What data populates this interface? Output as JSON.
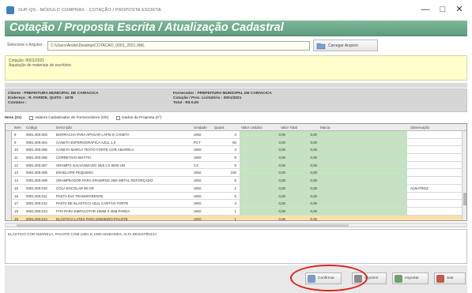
{
  "window": {
    "title": "SUP-QS - MÓDULO COMPRAS - COTAÇÃO / PROPOSTA ESCRITA",
    "controls": [
      "—",
      "□",
      "✕"
    ]
  },
  "header": {
    "title": "Cotação / Proposta Escrita / Atualização Cadastral"
  },
  "file_import": {
    "label": "Selecione o Arquivo:",
    "path": "C:\\Users\\Andre\\Desktop\\COTACAO_0001_2021.XML",
    "button_label": "Carregar Arquivo",
    "button_icon": "folder-icon"
  },
  "observation": {
    "line1": "Cotação: 0001/2021",
    "line2": "Aquisição de materiais de escritório"
  },
  "client": {
    "name": "Cliente :  PREFEITURA MUNICIPAL DE CARIACICA",
    "address": "Endereço :  R. FARIDE, QUITO - 1578",
    "contact": "Contatos :",
    "entity": "Fornecedor :  PREFEITURA MUNICIPAL DE CARIACICA",
    "bid": "Cotação / Proc. Licitatório :  0001/2021",
    "total": "Total :  R$ 0,00"
  },
  "tabs": [
    {
      "label": "Itens (21)"
    },
    {
      "label": "Valores Cadastrados de Fornecedores (0/0)"
    },
    {
      "label": "Dados da Proposta (0°)"
    }
  ],
  "grid": {
    "columns": [
      "Item",
      "Código",
      "Descrição",
      "Unidade",
      "Quant.",
      "Valor Unitário",
      "Valor Total",
      "Marca",
      "Observação"
    ],
    "rows": [
      {
        "item": "8",
        "code": "0001.000.003",
        "desc": "BORRACHA PARA APAGAR LÁPIS E CANETA",
        "unit": "UND",
        "qty": "4",
        "unitv": "0,00",
        "total": "0,00",
        "obs": ""
      },
      {
        "item": "9",
        "code": "0001.000.004",
        "desc": "CANETA ESFEROGRÁFICA AZUL 1,0",
        "unit": "PCT",
        "qty": "80",
        "unitv": "0,00",
        "total": "0,00",
        "obs": ""
      },
      {
        "item": "10",
        "code": "0001.000.005",
        "desc": "CANETA MARCA TEXTO FORTE COR AMARELA",
        "unit": "UND",
        "qty": "4",
        "unitv": "0,00",
        "total": "0,00",
        "obs": ""
      },
      {
        "item": "11",
        "code": "0001.000.006",
        "desc": "CORRETIVO EM FITA",
        "unit": "UND",
        "qty": "8",
        "unitv": "0,00",
        "total": "0,00",
        "obs": ""
      },
      {
        "item": "12",
        "code": "0001.000.007",
        "desc": "GRAMPO GALVANIZADO 26/6 CX 5000 UN",
        "unit": "CX",
        "qty": "6",
        "unitv": "0,00",
        "total": "0,00",
        "obs": ""
      },
      {
        "item": "13",
        "code": "0001.000.008",
        "desc": "ENVELOPE PEQUENO",
        "unit": "UND",
        "qty": "100",
        "unitv": "0,00",
        "total": "0,00",
        "obs": ""
      },
      {
        "item": "14",
        "code": "0001.000.009",
        "desc": "GRAMPEADOR PARA GRAMPOS 26/6 METAL REFORÇADO",
        "unit": "UND",
        "qty": "5",
        "unitv": "0,00",
        "total": "0,00",
        "obs": ""
      },
      {
        "item": "15",
        "code": "0001.000.010",
        "desc": "COLA ESCOLAR 90 GR",
        "unit": "UND",
        "qty": "2",
        "unitv": "0,00",
        "total": "0,00",
        "obs": "ALBATROZ"
      },
      {
        "item": "16",
        "code": "0001.000.011",
        "desc": "PASTA EVA TRANSPARENTE",
        "unit": "UND",
        "qty": "5",
        "unitv": "0,00",
        "total": "0,00",
        "obs": ""
      },
      {
        "item": "17",
        "code": "0001.000.012",
        "desc": "PASTA DE ELÁSTICO AZUL CARTÃO FORTE",
        "unit": "UND",
        "qty": "3",
        "unitv": "0,00",
        "total": "0,00",
        "obs": ""
      },
      {
        "item": "18",
        "code": "0001.000.013",
        "desc": "FITA PARA EMPACOTAR 45MM X 45M PARDA",
        "unit": "UND",
        "qty": "1",
        "unitv": "0,00",
        "total": "0,00",
        "obs": ""
      },
      {
        "item": "19",
        "code": "0001.000.014",
        "desc": "ELÁSTICO LATEX PARA DINHEIRO PACOTE",
        "unit": "UND",
        "qty": "1",
        "unitv": "0,00",
        "total": "0,00",
        "obs": ""
      },
      {
        "item": "21",
        "code": "0001.000.015",
        "desc": "ELÁSTICO COR AMARELA",
        "unit": "UND",
        "qty": "1",
        "unitv": "0,00",
        "total": "0,00",
        "obs": ""
      }
    ]
  },
  "description": {
    "text": "ELÁSTICO COR AMARELA, PACOTE COM 100G E 1000 UNIDADES, ALTA RESISTÊNCIA"
  },
  "buttons": [
    {
      "label": "Confirmar",
      "icon": "confirm-icon",
      "color": "#7a9cc6"
    },
    {
      "label": "Imprimir",
      "icon": "print-icon",
      "color": "#8a8a8a"
    },
    {
      "label": "Importar",
      "icon": "import-icon",
      "color": "#6fa070"
    },
    {
      "label": "Sair",
      "icon": "exit-icon",
      "color": "#c25b4a"
    }
  ],
  "colors": {
    "banner": "#6ea98c",
    "obs_bg": "#ffffcc",
    "value_col": "#c4e3c0",
    "selected_row": "#ffe0a8",
    "highlight_circle": "#e0201c"
  }
}
